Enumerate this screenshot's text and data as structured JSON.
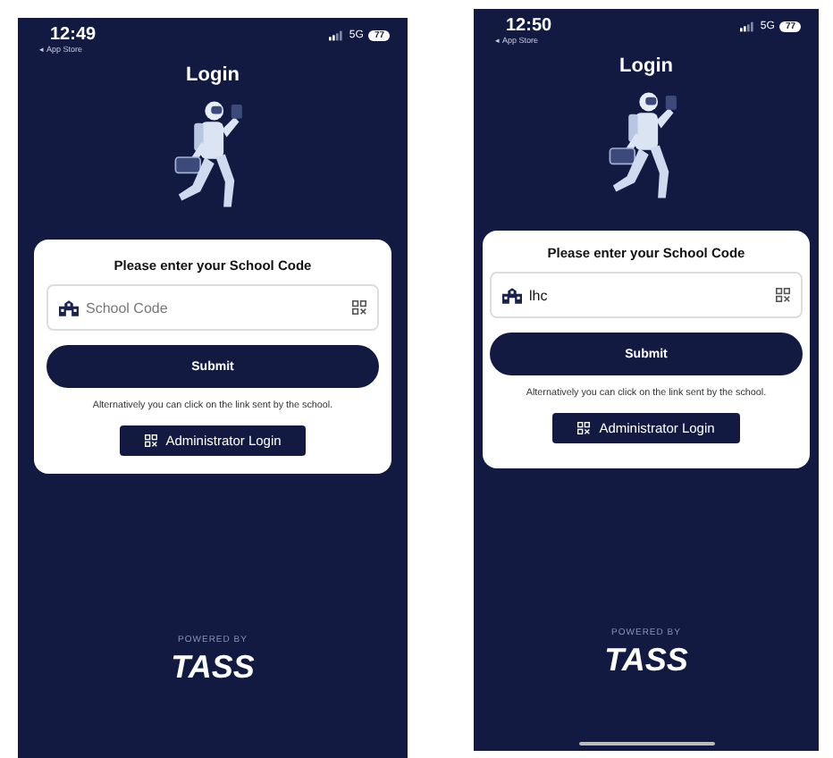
{
  "phones": [
    {
      "status_bar": {
        "time": "12:49",
        "back_label": "◂ App Store",
        "network": "5G",
        "battery": "77"
      },
      "title": "Login",
      "card": {
        "prompt": "Please enter your School Code",
        "field": {
          "placeholder": "School Code"
        },
        "submit": "Submit",
        "note": "Alternatively you can click on the link sent by the school.",
        "admin_button": "Administrator Login"
      },
      "footer": {
        "powered_by": "POWERED BY",
        "logo": "TASS"
      },
      "home_indicator": false
    },
    {
      "status_bar": {
        "time": "12:50",
        "back_label": "◂ App Store",
        "network": "5G",
        "battery": "77"
      },
      "title": "Login",
      "card": {
        "prompt": "Please enter your School Code",
        "field": {
          "value": "lhc"
        },
        "submit": "Submit",
        "note": "Alternatively you can click on the link sent by the school.",
        "admin_button": "Administrator Login"
      },
      "footer": {
        "powered_by": "POWERED BY",
        "logo": "TASS"
      },
      "home_indicator": true
    }
  ]
}
